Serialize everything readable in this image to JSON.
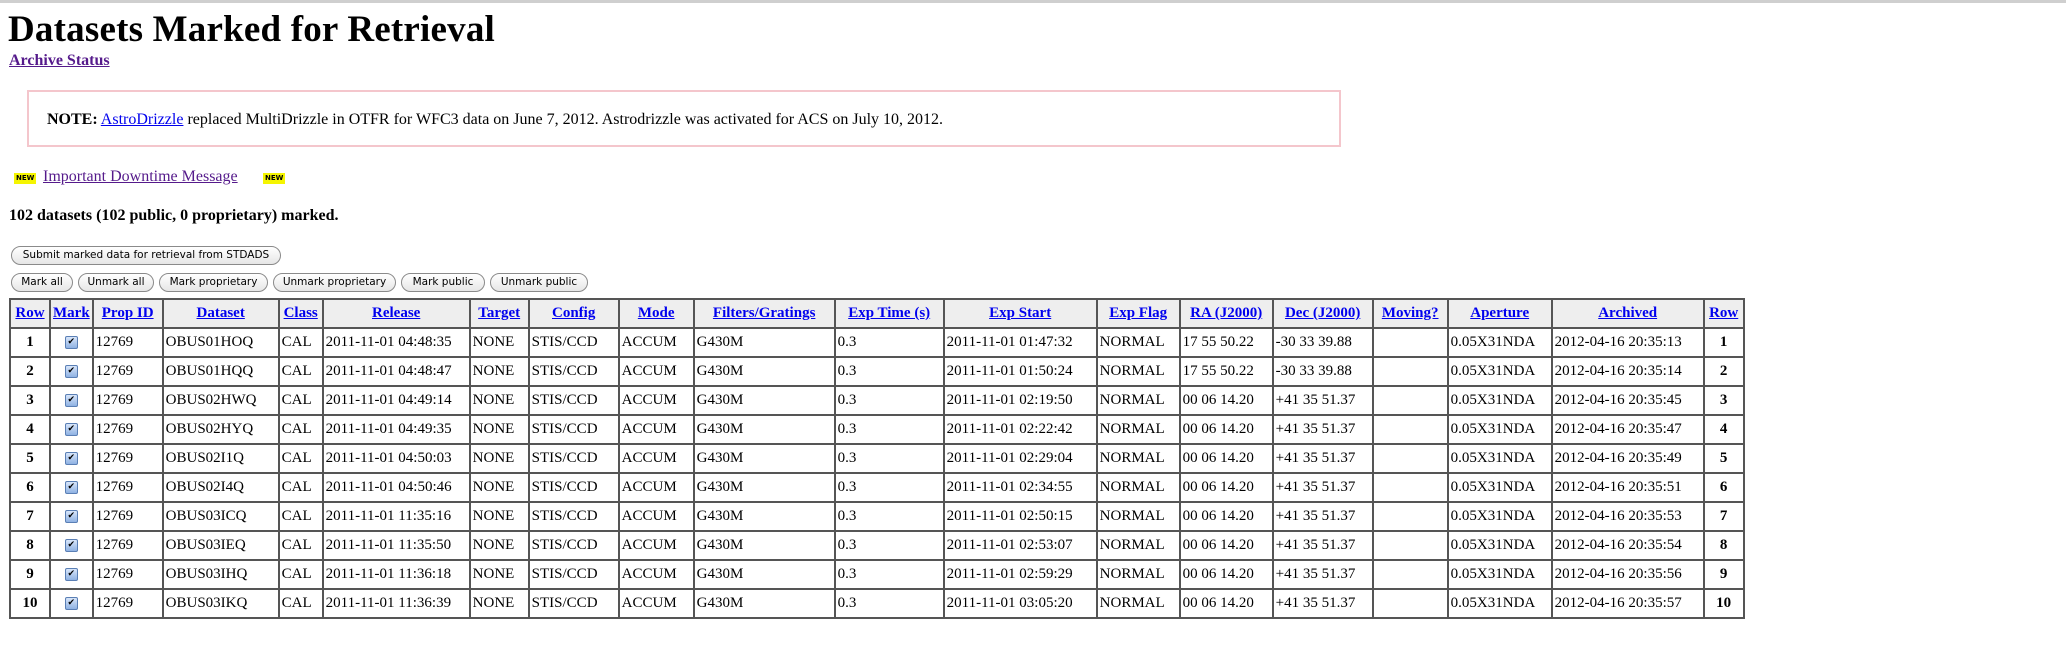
{
  "page": {
    "title": "Datasets Marked for Retrieval",
    "archive_status_link": "Archive Status"
  },
  "note": {
    "label": "NOTE:",
    "link": "AstroDrizzle",
    "text": " replaced MultiDrizzle in OTFR for WFC3 data on June 7, 2012. Astrodrizzle was activated for ACS on July 10, 2012."
  },
  "downtime": {
    "badge": "NEW",
    "link": "Important Downtime Message"
  },
  "summary": "102 datasets (102 public, 0 proprietary) marked.",
  "buttons": {
    "submit": "Submit marked data for retrieval from STDADS",
    "mark_all": "Mark all",
    "unmark_all": "Unmark all",
    "mark_proprietary": "Mark proprietary",
    "unmark_proprietary": "Unmark proprietary",
    "mark_public": "Mark public",
    "unmark_public": "Unmark public"
  },
  "table": {
    "columns": [
      "Row",
      "Mark",
      "Prop ID",
      "Dataset",
      "Class",
      "Release",
      "Target",
      "Config",
      "Mode",
      "Filters/Gratings",
      "Exp Time (s)",
      "Exp Start",
      "Exp Flag",
      "RA (J2000)",
      "Dec (J2000)",
      "Moving?",
      "Aperture",
      "Archived",
      "Row"
    ],
    "checkbox_glyph": "✔",
    "rows": [
      {
        "row": "1",
        "prop_id": "12769",
        "dataset": "OBUS01HOQ",
        "class": "CAL",
        "release": "2011-11-01 04:48:35",
        "target": "NONE",
        "config": "STIS/CCD",
        "mode": "ACCUM",
        "filters": "G430M",
        "exp_time": "0.3",
        "exp_start": "2011-11-01 01:47:32",
        "exp_flag": "NORMAL",
        "ra": "17 55 50.22",
        "dec": "-30 33 39.88",
        "moving": "",
        "aperture": "0.05X31NDA",
        "archived": "2012-04-16 20:35:13"
      },
      {
        "row": "2",
        "prop_id": "12769",
        "dataset": "OBUS01HQQ",
        "class": "CAL",
        "release": "2011-11-01 04:48:47",
        "target": "NONE",
        "config": "STIS/CCD",
        "mode": "ACCUM",
        "filters": "G430M",
        "exp_time": "0.3",
        "exp_start": "2011-11-01 01:50:24",
        "exp_flag": "NORMAL",
        "ra": "17 55 50.22",
        "dec": "-30 33 39.88",
        "moving": "",
        "aperture": "0.05X31NDA",
        "archived": "2012-04-16 20:35:14"
      },
      {
        "row": "3",
        "prop_id": "12769",
        "dataset": "OBUS02HWQ",
        "class": "CAL",
        "release": "2011-11-01 04:49:14",
        "target": "NONE",
        "config": "STIS/CCD",
        "mode": "ACCUM",
        "filters": "G430M",
        "exp_time": "0.3",
        "exp_start": "2011-11-01 02:19:50",
        "exp_flag": "NORMAL",
        "ra": "00 06 14.20",
        "dec": "+41 35 51.37",
        "moving": "",
        "aperture": "0.05X31NDA",
        "archived": "2012-04-16 20:35:45"
      },
      {
        "row": "4",
        "prop_id": "12769",
        "dataset": "OBUS02HYQ",
        "class": "CAL",
        "release": "2011-11-01 04:49:35",
        "target": "NONE",
        "config": "STIS/CCD",
        "mode": "ACCUM",
        "filters": "G430M",
        "exp_time": "0.3",
        "exp_start": "2011-11-01 02:22:42",
        "exp_flag": "NORMAL",
        "ra": "00 06 14.20",
        "dec": "+41 35 51.37",
        "moving": "",
        "aperture": "0.05X31NDA",
        "archived": "2012-04-16 20:35:47"
      },
      {
        "row": "5",
        "prop_id": "12769",
        "dataset": "OBUS02I1Q",
        "class": "CAL",
        "release": "2011-11-01 04:50:03",
        "target": "NONE",
        "config": "STIS/CCD",
        "mode": "ACCUM",
        "filters": "G430M",
        "exp_time": "0.3",
        "exp_start": "2011-11-01 02:29:04",
        "exp_flag": "NORMAL",
        "ra": "00 06 14.20",
        "dec": "+41 35 51.37",
        "moving": "",
        "aperture": "0.05X31NDA",
        "archived": "2012-04-16 20:35:49"
      },
      {
        "row": "6",
        "prop_id": "12769",
        "dataset": "OBUS02I4Q",
        "class": "CAL",
        "release": "2011-11-01 04:50:46",
        "target": "NONE",
        "config": "STIS/CCD",
        "mode": "ACCUM",
        "filters": "G430M",
        "exp_time": "0.3",
        "exp_start": "2011-11-01 02:34:55",
        "exp_flag": "NORMAL",
        "ra": "00 06 14.20",
        "dec": "+41 35 51.37",
        "moving": "",
        "aperture": "0.05X31NDA",
        "archived": "2012-04-16 20:35:51"
      },
      {
        "row": "7",
        "prop_id": "12769",
        "dataset": "OBUS03ICQ",
        "class": "CAL",
        "release": "2011-11-01 11:35:16",
        "target": "NONE",
        "config": "STIS/CCD",
        "mode": "ACCUM",
        "filters": "G430M",
        "exp_time": "0.3",
        "exp_start": "2011-11-01 02:50:15",
        "exp_flag": "NORMAL",
        "ra": "00 06 14.20",
        "dec": "+41 35 51.37",
        "moving": "",
        "aperture": "0.05X31NDA",
        "archived": "2012-04-16 20:35:53"
      },
      {
        "row": "8",
        "prop_id": "12769",
        "dataset": "OBUS03IEQ",
        "class": "CAL",
        "release": "2011-11-01 11:35:50",
        "target": "NONE",
        "config": "STIS/CCD",
        "mode": "ACCUM",
        "filters": "G430M",
        "exp_time": "0.3",
        "exp_start": "2011-11-01 02:53:07",
        "exp_flag": "NORMAL",
        "ra": "00 06 14.20",
        "dec": "+41 35 51.37",
        "moving": "",
        "aperture": "0.05X31NDA",
        "archived": "2012-04-16 20:35:54"
      },
      {
        "row": "9",
        "prop_id": "12769",
        "dataset": "OBUS03IHQ",
        "class": "CAL",
        "release": "2011-11-01 11:36:18",
        "target": "NONE",
        "config": "STIS/CCD",
        "mode": "ACCUM",
        "filters": "G430M",
        "exp_time": "0.3",
        "exp_start": "2011-11-01 02:59:29",
        "exp_flag": "NORMAL",
        "ra": "00 06 14.20",
        "dec": "+41 35 51.37",
        "moving": "",
        "aperture": "0.05X31NDA",
        "archived": "2012-04-16 20:35:56"
      },
      {
        "row": "10",
        "prop_id": "12769",
        "dataset": "OBUS03IKQ",
        "class": "CAL",
        "release": "2011-11-01 11:36:39",
        "target": "NONE",
        "config": "STIS/CCD",
        "mode": "ACCUM",
        "filters": "G430M",
        "exp_time": "0.3",
        "exp_start": "2011-11-01 03:05:20",
        "exp_flag": "NORMAL",
        "ra": "00 06 14.20",
        "dec": "+41 35 51.37",
        "moving": "",
        "aperture": "0.05X31NDA",
        "archived": "2012-04-16 20:35:57"
      }
    ]
  }
}
